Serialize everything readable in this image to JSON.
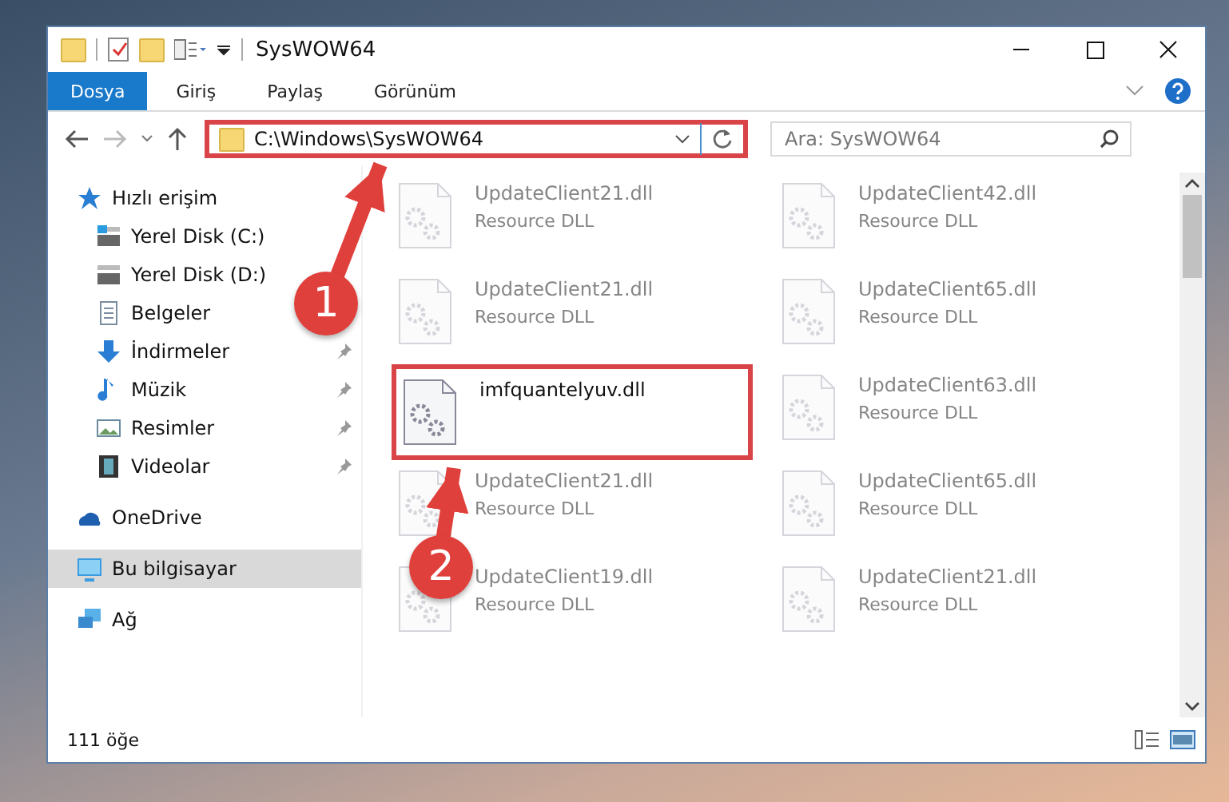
{
  "window": {
    "title": "SysWOW64"
  },
  "ribbon_tabs": [
    {
      "label": "Dosya",
      "selected": true
    },
    {
      "label": "Giriş",
      "selected": false
    },
    {
      "label": "Paylaş",
      "selected": false
    },
    {
      "label": "Görünüm",
      "selected": false
    }
  ],
  "address": {
    "path": "C:\\Windows\\SysWOW64",
    "highlighted": true
  },
  "search": {
    "placeholder": "Ara: SysWOW64"
  },
  "sidebar": {
    "items": [
      {
        "label": "Hızlı erişim",
        "kind": "star",
        "pinned": false,
        "selected": false
      },
      {
        "label": "Yerel Disk (C:)",
        "kind": "disk-c",
        "pinned": false,
        "selected": false
      },
      {
        "label": "Yerel Disk (D:)",
        "kind": "disk",
        "pinned": false,
        "selected": false
      },
      {
        "label": "Belgeler",
        "kind": "doc",
        "pinned": false,
        "selected": false
      },
      {
        "label": "İndirmeler",
        "kind": "download",
        "pinned": true,
        "selected": false
      },
      {
        "label": "Müzik",
        "kind": "music",
        "pinned": true,
        "selected": false
      },
      {
        "label": "Resimler",
        "kind": "picture",
        "pinned": true,
        "selected": false
      },
      {
        "label": "Videolar",
        "kind": "video",
        "pinned": true,
        "selected": false
      },
      {
        "label": "OneDrive",
        "kind": "cloud",
        "pinned": false,
        "selected": false
      },
      {
        "label": "Bu bilgisayar",
        "kind": "pc",
        "pinned": false,
        "selected": true
      },
      {
        "label": "Ağ",
        "kind": "network",
        "pinned": false,
        "selected": false
      }
    ]
  },
  "files": [
    {
      "name": "UpdateClient21.dll",
      "type": "Resource DLL",
      "highlighted": false
    },
    {
      "name": "UpdateClient42.dll",
      "type": "Resource DLL",
      "highlighted": false
    },
    {
      "name": "UpdateClient21.dll",
      "type": "Resource DLL",
      "highlighted": false
    },
    {
      "name": "UpdateClient65.dll",
      "type": "Resource DLL",
      "highlighted": false
    },
    {
      "name": "imfquantelyuv.dll",
      "highlighted": true
    },
    {
      "name": "UpdateClient63.dll",
      "type": "Resource DLL",
      "highlighted": false
    },
    {
      "name": "UpdateClient21.dll",
      "type": "Resource DLL",
      "highlighted": false
    },
    {
      "name": "UpdateClient65.dll",
      "type": "Resource DLL",
      "highlighted": false
    },
    {
      "name": "UpdateClient19.dll",
      "type": "Resource DLL",
      "highlighted": false
    },
    {
      "name": "UpdateClient21.dll",
      "type": "Resource DLL",
      "highlighted": false
    }
  ],
  "status_bar": {
    "count": "111 öğe"
  },
  "annotations": [
    {
      "label": "1"
    },
    {
      "label": "2"
    }
  ]
}
